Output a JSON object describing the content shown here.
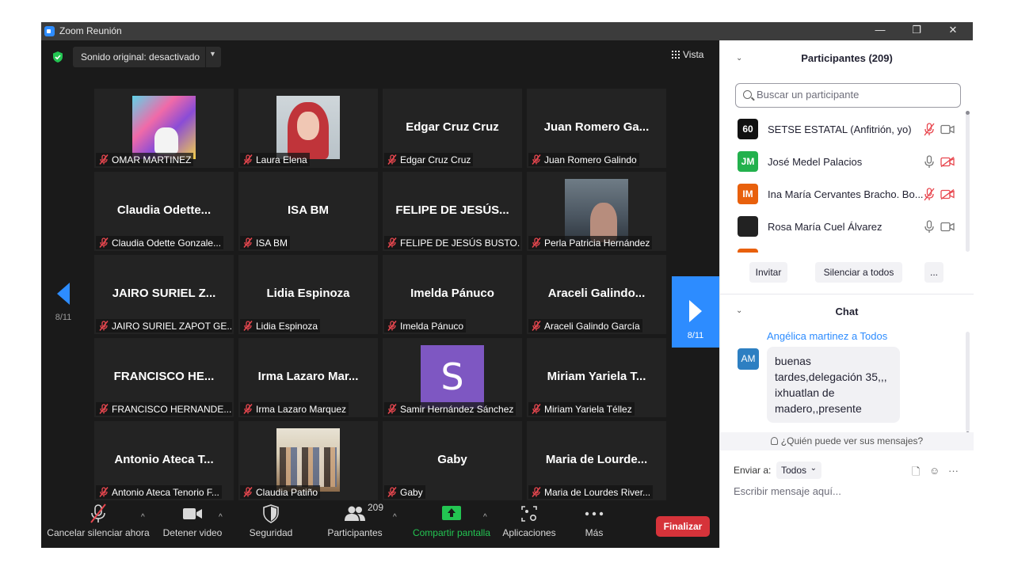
{
  "window": {
    "title": "Zoom Reunión",
    "controls": [
      "—",
      "❐",
      "✕"
    ]
  },
  "top_bar": {
    "audio_status": "Sonido original: desactivado",
    "view_label": "Vista"
  },
  "navigation": {
    "page_left": "8/11",
    "page_right": "8/11"
  },
  "tiles": [
    {
      "name": "",
      "label": "OMAR MARTINEZ",
      "photo": "omar"
    },
    {
      "name": "",
      "label": "Laura Elena",
      "photo": "laura"
    },
    {
      "name": "Edgar Cruz Cruz",
      "label": "Edgar Cruz Cruz"
    },
    {
      "name": "Juan Romero Ga...",
      "label": "Juan Romero Galindo"
    },
    {
      "name": "Claudia  Odette...",
      "label": "Claudia Odette Gonzale..."
    },
    {
      "name": "ISA BM",
      "label": "ISA BM"
    },
    {
      "name": "FELIPE DE JESÚS...",
      "label": "FELIPE DE JESÚS BUSTO..."
    },
    {
      "name": "",
      "label": "Perla Patricia Hernández",
      "photo": "perla"
    },
    {
      "name": "JAIRO SURIEL Z...",
      "label": "JAIRO SURIEL ZAPOT GE..."
    },
    {
      "name": "Lidia Espinoza",
      "label": "Lidia Espinoza"
    },
    {
      "name": "Imelda Pánuco",
      "label": "Imelda Pánuco"
    },
    {
      "name": "Araceli  Galindo...",
      "label": "Araceli Galindo García"
    },
    {
      "name": "FRANCISCO  HE...",
      "label": "FRANCISCO HERNANDE..."
    },
    {
      "name": "Irma Lazaro Mar...",
      "label": "Irma Lazaro Marquez"
    },
    {
      "name": "",
      "label": "Samir Hernández Sánchez",
      "photo": "samir",
      "initial": "S"
    },
    {
      "name": "Miriam Yariela T...",
      "label": "Miriam Yariela Téllez"
    },
    {
      "name": "Antonio Ateca T...",
      "label": "Antonio Ateca Tenorio F..."
    },
    {
      "name": "",
      "label": "Claudia Patiño",
      "photo": "group"
    },
    {
      "name": "Gaby",
      "label": "Gaby"
    },
    {
      "name": "Maria de Lourde...",
      "label": "Maria de Lourdes River..."
    }
  ],
  "toolbar": {
    "unmute": "Cancelar silenciar ahora",
    "stop_video": "Detener video",
    "security": "Seguridad",
    "participants": "Participantes",
    "participants_count": "209",
    "share": "Compartir pantalla",
    "apps": "Aplicaciones",
    "more": "Más",
    "end": "Finalizar"
  },
  "participants_panel": {
    "title": "Participantes (209)",
    "search_placeholder": "Buscar un participante",
    "list": [
      {
        "initials": "60",
        "name": "SETSE ESTATAL (Anfitrión, yo)",
        "color": "#111111",
        "mic_muted": true,
        "cam_off": false
      },
      {
        "initials": "JM",
        "name": "José Medel Palacios",
        "color": "#23b14d",
        "mic_muted": false,
        "cam_off": true
      },
      {
        "initials": "IM",
        "name": "Ina María Cervantes Bracho. Bo...",
        "color": "#e8600c",
        "mic_muted": true,
        "cam_off": true
      },
      {
        "initials": "",
        "name": "Rosa María Cuel Álvarez",
        "color": "#222222",
        "mic_muted": false,
        "cam_off": false
      },
      {
        "initials": "",
        "name": "",
        "color": "#e8600c",
        "mic_muted": true,
        "cam_off": true
      }
    ],
    "invite": "Invitar",
    "mute_all": "Silenciar a todos",
    "more": "..."
  },
  "chat": {
    "title": "Chat",
    "sender": "Angélica martinez a Todos",
    "avatar": "AM",
    "message": "buenas tardes,delegación 35,,, ixhuatlan de madero,,presente",
    "who_sees": "¿Quién puede ver sus mensajes?",
    "send_to_label": "Enviar a:",
    "send_to_value": "Todos",
    "input_placeholder": "Escribir mensaje aquí..."
  },
  "colors": {
    "accent": "#2d8cff",
    "end_red": "#d6333a",
    "share_green": "#23c552",
    "muted_red": "#e8474f"
  }
}
